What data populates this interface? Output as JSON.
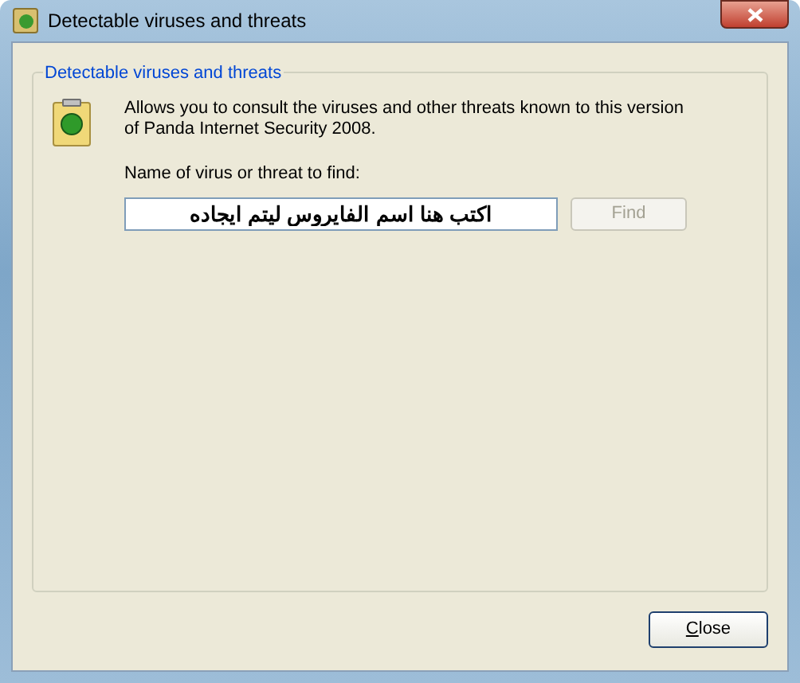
{
  "window": {
    "title": "Detectable viruses and threats"
  },
  "group": {
    "title": "Detectable viruses and threats",
    "description": "Allows you to consult the viruses and other threats known to this version of Panda Internet Security 2008.",
    "field_label": "Name of virus or threat to find:",
    "search": {
      "value": "اكتب هنا اسم الفايروس ليتم ايجاده"
    },
    "find_button": {
      "label": "Find",
      "disabled": true
    }
  },
  "buttons": [
    {
      "label": "Close"
    }
  ]
}
